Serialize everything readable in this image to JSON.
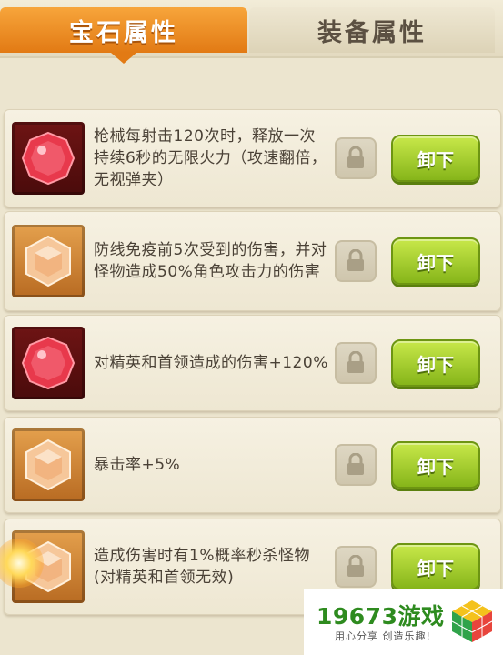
{
  "tabs": [
    {
      "label": "宝石属性",
      "active": true
    },
    {
      "label": "装备属性",
      "active": false
    }
  ],
  "gems": [
    {
      "color": "red",
      "description": "枪械每射击120次时，释放一次持续6秒的无限火力（攻速翻倍，无视弹夹）",
      "button": "卸下"
    },
    {
      "color": "orange",
      "description": "防线免疫前5次受到的伤害，并对怪物造成50%角色攻击力的伤害",
      "button": "卸下"
    },
    {
      "color": "red",
      "description": "对精英和首领造成的伤害+120%",
      "button": "卸下"
    },
    {
      "color": "orange",
      "description": "暴击率+5%",
      "button": "卸下"
    },
    {
      "color": "orange",
      "description": "造成伤害时有1%概率秒杀怪物(对精英和首领无效)",
      "button": "卸下"
    }
  ],
  "watermark": {
    "text": "19673游戏",
    "slogan": "用心分享 创造乐趣!"
  }
}
